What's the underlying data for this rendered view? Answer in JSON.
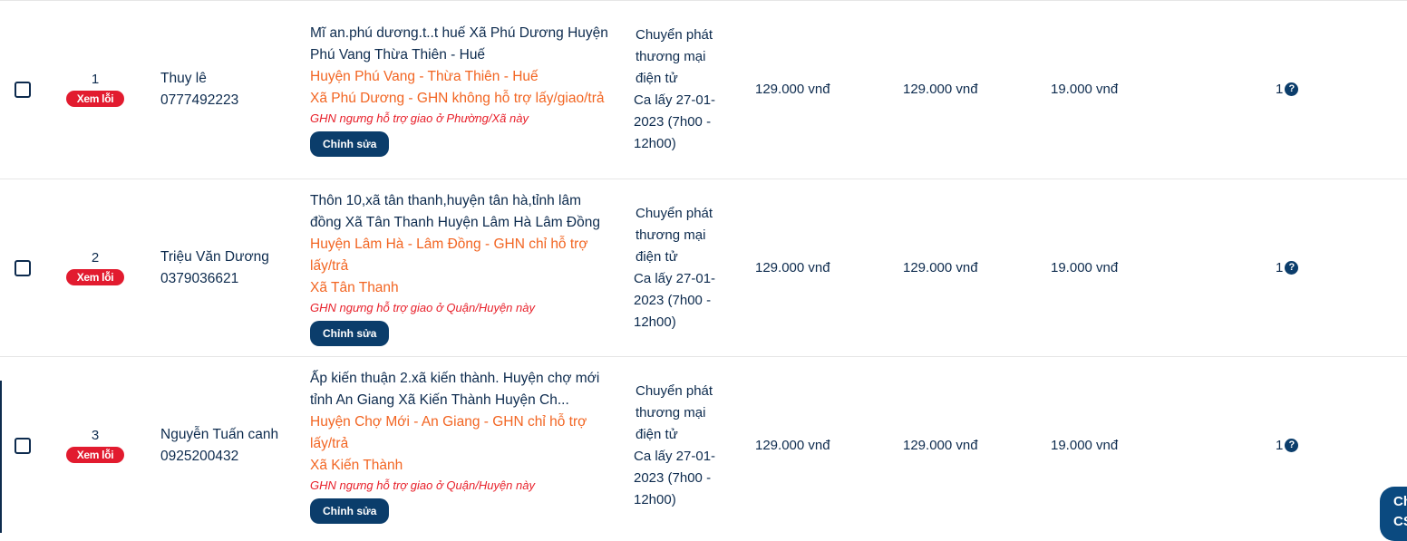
{
  "rows": [
    {
      "index": "1",
      "error_badge": "Xem lỗi",
      "name": "Thuy lê",
      "phone": "0777492223",
      "address": "Mĩ an.phú dương.t..t huế Xã Phú Dương Huyện Phú Vang Thừa Thiên - Huế",
      "district_note": "Huyện Phú Vang - Thừa Thiên - Huế",
      "ward_note": "Xã Phú Dương - GHN không hỗ trợ lấy/giao/trả",
      "warning": "GHN ngưng hỗ trợ giao ở Phường/Xã này",
      "edit_label": "Chỉnh sửa",
      "service": "Chuyển phát thương mại điện tử",
      "pickup": "Ca lấy 27-01-2023 (7h00 - 12h00)",
      "amount1": "129.000 vnđ",
      "amount2": "129.000 vnđ",
      "fee": "19.000 vnđ",
      "count": "1"
    },
    {
      "index": "2",
      "error_badge": "Xem lỗi",
      "name": "Triệu Văn Dương",
      "phone": "0379036621",
      "address": "Thôn 10,xã tân thanh,huyện tân hà,tỉnh lâm đồng Xã Tân Thanh Huyện Lâm Hà Lâm Đồng",
      "district_note": "Huyện Lâm Hà - Lâm Đồng - GHN chỉ hỗ trợ lấy/trả",
      "ward_note": "Xã Tân Thanh",
      "warning": "GHN ngưng hỗ trợ giao ở Quận/Huyện này",
      "edit_label": "Chỉnh sửa",
      "service": "Chuyển phát thương mại điện tử",
      "pickup": "Ca lấy 27-01-2023 (7h00 - 12h00)",
      "amount1": "129.000 vnđ",
      "amount2": "129.000 vnđ",
      "fee": "19.000 vnđ",
      "count": "1"
    },
    {
      "index": "3",
      "error_badge": "Xem lỗi",
      "name": "Nguyễn Tuấn canh",
      "phone": "0925200432",
      "address": "Ấp kiến thuận 2.xã kiến thành. Huyện chợ mới tỉnh An Giang Xã Kiến Thành Huyện Ch...",
      "district_note": "Huyện Chợ Mới - An Giang - GHN chỉ hỗ trợ lấy/trả",
      "ward_note": "Xã Kiến Thành",
      "warning": "GHN ngưng hỗ trợ giao ở Quận/Huyện này",
      "edit_label": "Chỉnh sửa",
      "service": "Chuyển phát thương mại điện tử",
      "pickup": "Ca lấy 27-01-2023 (7h00 - 12h00)",
      "amount1": "129.000 vnđ",
      "amount2": "129.000 vnđ",
      "fee": "19.000 vnđ",
      "count": "1"
    }
  ],
  "chat_widget": {
    "line1": "Ch",
    "line2": "CS"
  },
  "colors": {
    "text": "#0d2b4e",
    "orange": "#f26522",
    "error": "#e21b2f",
    "button": "#0b3d6b"
  }
}
